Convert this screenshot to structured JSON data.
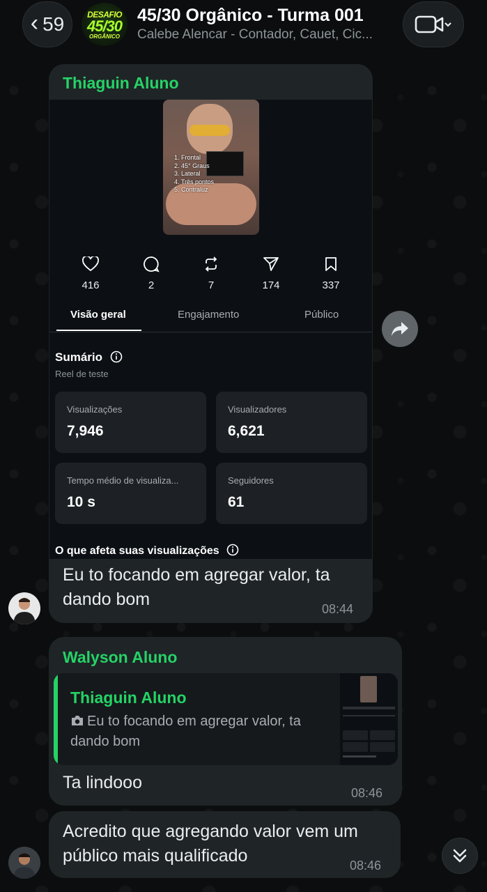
{
  "header": {
    "back_count": "59",
    "group_avatar_lines": [
      "DESAFIO",
      "45/30",
      "ORGÂNICO"
    ],
    "title": "45/30 Orgânico - Turma 001",
    "subtitle": "Calebe Alencar - Contador, Cauet, Cic..."
  },
  "messages": [
    {
      "sender": "Thiaguin Aluno",
      "text": "Eu to focando em agregar valor, ta dando bom",
      "time": "08:44",
      "attachment": {
        "reel_overlay_list": [
          "1. Frontal",
          "2. 45° Graus",
          "3. Lateral",
          "4. Três pontos",
          "5. Contraluz"
        ],
        "stats": [
          {
            "icon": "heart-icon",
            "value": "416"
          },
          {
            "icon": "comment-icon",
            "value": "2"
          },
          {
            "icon": "repost-icon",
            "value": "7"
          },
          {
            "icon": "send-icon",
            "value": "174"
          },
          {
            "icon": "bookmark-icon",
            "value": "337"
          }
        ],
        "tabs": [
          "Visão geral",
          "Engajamento",
          "Público"
        ],
        "summary_title": "Sumário",
        "summary_sub": "Reel de teste",
        "cards": [
          {
            "label": "Visualizações",
            "value": "7,946"
          },
          {
            "label": "Visualizadores",
            "value": "6,621"
          },
          {
            "label": "Tempo médio de visualiza...",
            "value": "10 s"
          },
          {
            "label": "Seguidores",
            "value": "61"
          }
        ],
        "affects_title": "O que afeta suas visualizações"
      }
    },
    {
      "sender": "Walyson Aluno",
      "quote": {
        "sender": "Thiaguin Aluno",
        "text": "Eu to focando em agregar valor, ta dando bom"
      },
      "text": "Ta lindooo",
      "time": "08:46"
    },
    {
      "text": "Acredito que agregando valor vem um público mais qualificado",
      "time": "08:46"
    }
  ],
  "colors": {
    "accent": "#25d366",
    "bubble": "#1f2427",
    "background": "#0b0d0e"
  }
}
